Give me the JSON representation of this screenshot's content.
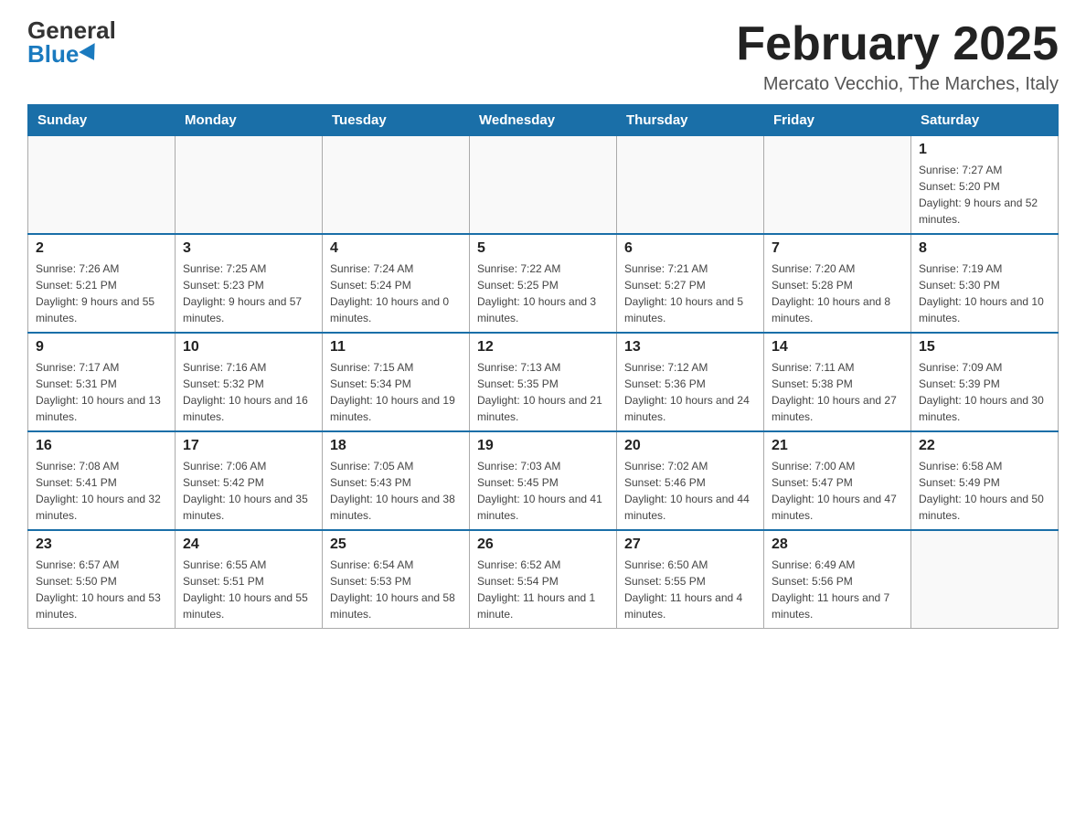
{
  "header": {
    "logo_general": "General",
    "logo_blue": "Blue",
    "title": "February 2025",
    "location": "Mercato Vecchio, The Marches, Italy"
  },
  "weekdays": [
    "Sunday",
    "Monday",
    "Tuesday",
    "Wednesday",
    "Thursday",
    "Friday",
    "Saturday"
  ],
  "weeks": [
    [
      {
        "day": "",
        "info": ""
      },
      {
        "day": "",
        "info": ""
      },
      {
        "day": "",
        "info": ""
      },
      {
        "day": "",
        "info": ""
      },
      {
        "day": "",
        "info": ""
      },
      {
        "day": "",
        "info": ""
      },
      {
        "day": "1",
        "info": "Sunrise: 7:27 AM\nSunset: 5:20 PM\nDaylight: 9 hours and 52 minutes."
      }
    ],
    [
      {
        "day": "2",
        "info": "Sunrise: 7:26 AM\nSunset: 5:21 PM\nDaylight: 9 hours and 55 minutes."
      },
      {
        "day": "3",
        "info": "Sunrise: 7:25 AM\nSunset: 5:23 PM\nDaylight: 9 hours and 57 minutes."
      },
      {
        "day": "4",
        "info": "Sunrise: 7:24 AM\nSunset: 5:24 PM\nDaylight: 10 hours and 0 minutes."
      },
      {
        "day": "5",
        "info": "Sunrise: 7:22 AM\nSunset: 5:25 PM\nDaylight: 10 hours and 3 minutes."
      },
      {
        "day": "6",
        "info": "Sunrise: 7:21 AM\nSunset: 5:27 PM\nDaylight: 10 hours and 5 minutes."
      },
      {
        "day": "7",
        "info": "Sunrise: 7:20 AM\nSunset: 5:28 PM\nDaylight: 10 hours and 8 minutes."
      },
      {
        "day": "8",
        "info": "Sunrise: 7:19 AM\nSunset: 5:30 PM\nDaylight: 10 hours and 10 minutes."
      }
    ],
    [
      {
        "day": "9",
        "info": "Sunrise: 7:17 AM\nSunset: 5:31 PM\nDaylight: 10 hours and 13 minutes."
      },
      {
        "day": "10",
        "info": "Sunrise: 7:16 AM\nSunset: 5:32 PM\nDaylight: 10 hours and 16 minutes."
      },
      {
        "day": "11",
        "info": "Sunrise: 7:15 AM\nSunset: 5:34 PM\nDaylight: 10 hours and 19 minutes."
      },
      {
        "day": "12",
        "info": "Sunrise: 7:13 AM\nSunset: 5:35 PM\nDaylight: 10 hours and 21 minutes."
      },
      {
        "day": "13",
        "info": "Sunrise: 7:12 AM\nSunset: 5:36 PM\nDaylight: 10 hours and 24 minutes."
      },
      {
        "day": "14",
        "info": "Sunrise: 7:11 AM\nSunset: 5:38 PM\nDaylight: 10 hours and 27 minutes."
      },
      {
        "day": "15",
        "info": "Sunrise: 7:09 AM\nSunset: 5:39 PM\nDaylight: 10 hours and 30 minutes."
      }
    ],
    [
      {
        "day": "16",
        "info": "Sunrise: 7:08 AM\nSunset: 5:41 PM\nDaylight: 10 hours and 32 minutes."
      },
      {
        "day": "17",
        "info": "Sunrise: 7:06 AM\nSunset: 5:42 PM\nDaylight: 10 hours and 35 minutes."
      },
      {
        "day": "18",
        "info": "Sunrise: 7:05 AM\nSunset: 5:43 PM\nDaylight: 10 hours and 38 minutes."
      },
      {
        "day": "19",
        "info": "Sunrise: 7:03 AM\nSunset: 5:45 PM\nDaylight: 10 hours and 41 minutes."
      },
      {
        "day": "20",
        "info": "Sunrise: 7:02 AM\nSunset: 5:46 PM\nDaylight: 10 hours and 44 minutes."
      },
      {
        "day": "21",
        "info": "Sunrise: 7:00 AM\nSunset: 5:47 PM\nDaylight: 10 hours and 47 minutes."
      },
      {
        "day": "22",
        "info": "Sunrise: 6:58 AM\nSunset: 5:49 PM\nDaylight: 10 hours and 50 minutes."
      }
    ],
    [
      {
        "day": "23",
        "info": "Sunrise: 6:57 AM\nSunset: 5:50 PM\nDaylight: 10 hours and 53 minutes."
      },
      {
        "day": "24",
        "info": "Sunrise: 6:55 AM\nSunset: 5:51 PM\nDaylight: 10 hours and 55 minutes."
      },
      {
        "day": "25",
        "info": "Sunrise: 6:54 AM\nSunset: 5:53 PM\nDaylight: 10 hours and 58 minutes."
      },
      {
        "day": "26",
        "info": "Sunrise: 6:52 AM\nSunset: 5:54 PM\nDaylight: 11 hours and 1 minute."
      },
      {
        "day": "27",
        "info": "Sunrise: 6:50 AM\nSunset: 5:55 PM\nDaylight: 11 hours and 4 minutes."
      },
      {
        "day": "28",
        "info": "Sunrise: 6:49 AM\nSunset: 5:56 PM\nDaylight: 11 hours and 7 minutes."
      },
      {
        "day": "",
        "info": ""
      }
    ]
  ]
}
